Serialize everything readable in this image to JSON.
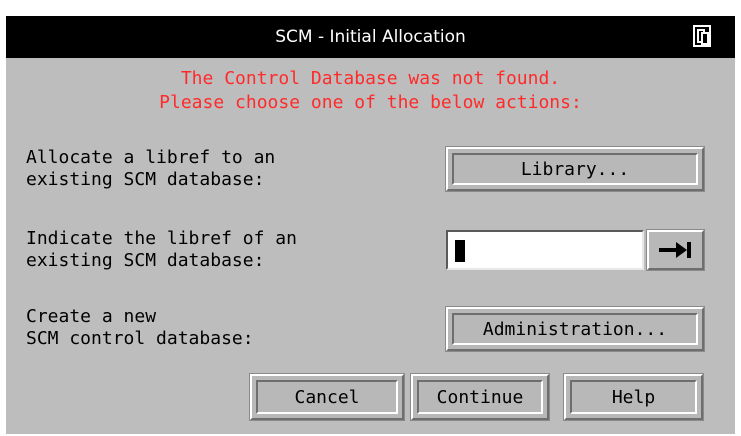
{
  "window": {
    "title": "SCM - Initial Allocation"
  },
  "message": {
    "line1": "The Control Database was not found.",
    "line2": "Please choose one of the below actions:"
  },
  "options": {
    "allocate": {
      "line1": "Allocate a libref to an",
      "line2": "existing SCM database:",
      "button_label": "Library..."
    },
    "indicate": {
      "line1": "Indicate the libref of an",
      "line2": "existing SCM database:",
      "input_value": ""
    },
    "create": {
      "line1": "Create a new",
      "line2": "SCM control database:",
      "button_label": "Administration..."
    }
  },
  "footer": {
    "cancel_label": "Cancel",
    "continue_label": "Continue",
    "help_label": "Help"
  },
  "icons": {
    "title_icon": "window-menu-icon",
    "go_icon": "arrow-to-bar-right-icon"
  },
  "colors": {
    "title_bar": "#000000",
    "dialog_bg": "#bdbdbd",
    "message_text": "#ff2a2a"
  }
}
